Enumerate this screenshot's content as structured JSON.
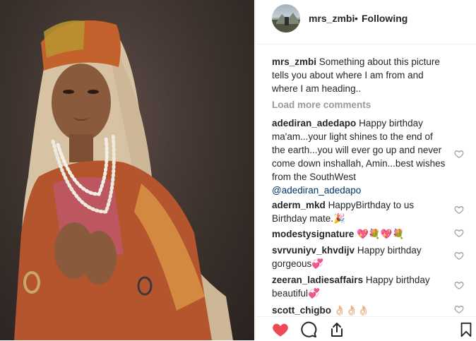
{
  "post": {
    "username": "mrs_zmbi",
    "separator": "•",
    "follow_status": "Following"
  },
  "caption": {
    "username": "mrs_zmbi",
    "text": "Something about this picture tells you about where I am from and where I am heading.."
  },
  "load_more": "Load more comments",
  "comments": [
    {
      "username": "adediran_adedapo",
      "text": "Happy birthday ma'am...your light shines to the end of the earth...you will ever go up and never come down inshallah, Amin...best wishes from the SouthWest",
      "mention": "@adediran_adedapo"
    },
    {
      "username": "aderm_mkd",
      "text": "HappyBirthday to us Birthday mate.🎉"
    },
    {
      "username": "modestysignature",
      "text": "💖💐💖💐"
    },
    {
      "username": "svrvuniyv_khvdijv",
      "text": "Happy birthday gorgeous💞"
    },
    {
      "username": "zeeran_ladiesaffairs",
      "text": "Happy birthday beautiful💞"
    },
    {
      "username": "scott_chigbo",
      "text": "👌🏻👌🏻👌🏻"
    }
  ],
  "icons": {
    "like": "heart-filled-icon",
    "comment": "comment-icon",
    "share": "share-icon",
    "save": "bookmark-icon",
    "comment_like": "heart-outline-icon"
  },
  "colors": {
    "like_red": "#ed4956",
    "mention_blue": "#003569",
    "muted_gray": "#999999"
  }
}
